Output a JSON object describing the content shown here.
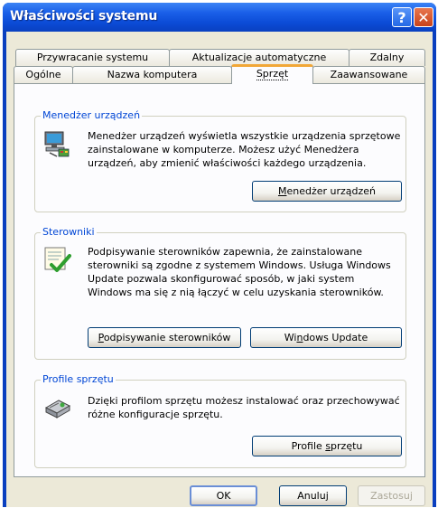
{
  "window": {
    "title": "Właściwości systemu"
  },
  "tabs_row1": [
    {
      "label": "Przywracanie systemu"
    },
    {
      "label": "Aktualizacje automatyczne"
    },
    {
      "label": "Zdalny"
    }
  ],
  "tabs_row2": [
    {
      "label": "Ogólne"
    },
    {
      "label": "Nazwa komputera"
    },
    {
      "label": "Sprzęt"
    },
    {
      "label": "Zaawansowane"
    }
  ],
  "device_manager": {
    "group_label": "Menedżer urządzeń",
    "line1": "Menedżer urządzeń wyświetla wszystkie urządzenia sprzętowe",
    "line2": "zainstalowane w komputerze. Możesz użyć Menedżera",
    "line3": "urządzeń, aby zmienić właściwości każdego urządzenia.",
    "button_pre": "",
    "button_key": "M",
    "button_post": "enedżer urządzeń"
  },
  "drivers": {
    "group_label": "Sterowniki",
    "line1": "Podpisywanie sterowników zapewnia, że zainstalowane",
    "line2": "sterowniki są zgodne z systemem Windows. Usługa Windows",
    "line3": "Update pozwala skonfigurować sposób, w jaki system",
    "line4": "Windows ma się z nią łączyć w celu uzyskania sterowników.",
    "signing_pre": "",
    "signing_key": "P",
    "signing_post": "odpisywanie sterowników",
    "update_pre": "Wi",
    "update_key": "n",
    "update_post": "dows Update"
  },
  "profiles": {
    "group_label": "Profile sprzętu",
    "line1": "Dzięki profilom sprzętu możesz instalować oraz przechowywać",
    "line2": "różne konfiguracje sprzętu.",
    "button_pre": "Profile ",
    "button_key": "s",
    "button_post": "przętu"
  },
  "footer": {
    "ok": "OK",
    "cancel": "Anuluj",
    "apply": "Zastosuj"
  }
}
